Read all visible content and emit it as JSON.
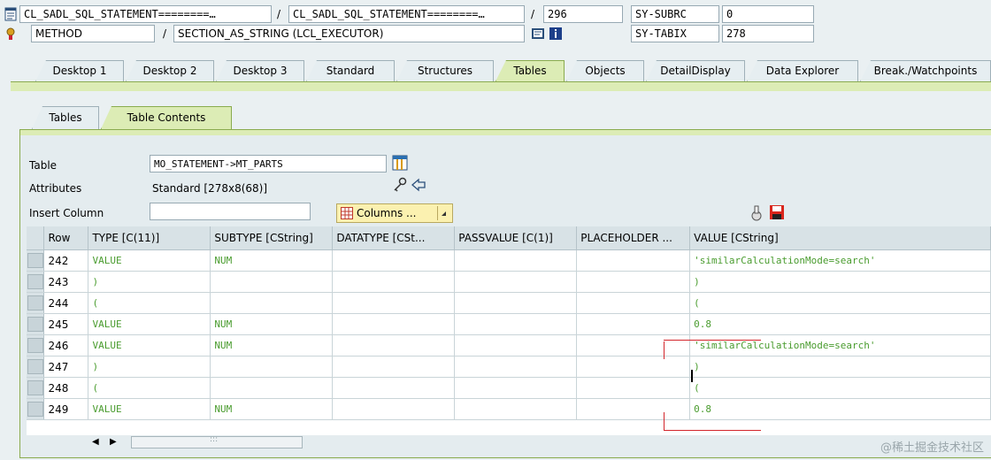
{
  "header": {
    "program_field_1": "CL_SADL_SQL_STATEMENT========…",
    "separator_1": "/",
    "program_field_2": "CL_SADL_SQL_STATEMENT========…",
    "separator_2": "/",
    "line_number": "296",
    "sy_subrc_label": "SY-SUBRC",
    "sy_subrc_value": "0",
    "type_field": "METHOD",
    "separator_3": "/",
    "method_field": "SECTION_AS_STRING (LCL_EXECUTOR)",
    "sy_tabix_label": "SY-TABIX",
    "sy_tabix_value": "278"
  },
  "main_tabs": [
    {
      "label": "Desktop 1"
    },
    {
      "label": "Desktop 2"
    },
    {
      "label": "Desktop 3"
    },
    {
      "label": "Standard"
    },
    {
      "label": "Structures"
    },
    {
      "label": "Tables"
    },
    {
      "label": "Objects"
    },
    {
      "label": "DetailDisplay"
    },
    {
      "label": "Data Explorer"
    },
    {
      "label": "Break./Watchpoints"
    }
  ],
  "sub_tabs": [
    {
      "label": "Tables"
    },
    {
      "label": "Table Contents"
    }
  ],
  "form": {
    "table_label": "Table",
    "table_value": "MO_STATEMENT->MT_PARTS",
    "attributes_label": "Attributes",
    "attributes_value": "Standard [278x8(68)]",
    "insert_column_label": "Insert Column",
    "insert_column_value": "",
    "columns_button": "Columns ..."
  },
  "table": {
    "headers": [
      "Row",
      "TYPE [C(11)]",
      "SUBTYPE [CString]",
      "DATATYPE [CSt...",
      "PASSVALUE [C(1)]",
      "PLACEHOLDER ...",
      "VALUE [CString]"
    ],
    "rows": [
      {
        "row": "242",
        "type": "VALUE",
        "subtype": "NUM",
        "datatype": "",
        "passvalue": "",
        "placeholder": "",
        "value": "'similarCalculationMode=search'"
      },
      {
        "row": "243",
        "type": ")",
        "subtype": "",
        "datatype": "",
        "passvalue": "",
        "placeholder": "",
        "value": ")"
      },
      {
        "row": "244",
        "type": "(",
        "subtype": "",
        "datatype": "",
        "passvalue": "",
        "placeholder": "",
        "value": "("
      },
      {
        "row": "245",
        "type": "VALUE",
        "subtype": "NUM",
        "datatype": "",
        "passvalue": "",
        "placeholder": "",
        "value": "0.8"
      },
      {
        "row": "246",
        "type": "VALUE",
        "subtype": "NUM",
        "datatype": "",
        "passvalue": "",
        "placeholder": "",
        "value": "'similarCalculationMode=search'"
      },
      {
        "row": "247",
        "type": ")",
        "subtype": "",
        "datatype": "",
        "passvalue": "",
        "placeholder": "",
        "value": ")"
      },
      {
        "row": "248",
        "type": "(",
        "subtype": "",
        "datatype": "",
        "passvalue": "",
        "placeholder": "",
        "value": "("
      },
      {
        "row": "249",
        "type": "VALUE",
        "subtype": "NUM",
        "datatype": "",
        "passvalue": "",
        "placeholder": "",
        "value": "0.8"
      }
    ]
  },
  "scrollbar": {
    "grip": ":::"
  },
  "watermark": "@稀土掘金技术社区",
  "colors": {
    "accent_green": "#dcecb5",
    "value_text": "#4a9c2f",
    "highlight_red": "#d3262b",
    "button_yellow": "#fbf1b0"
  }
}
